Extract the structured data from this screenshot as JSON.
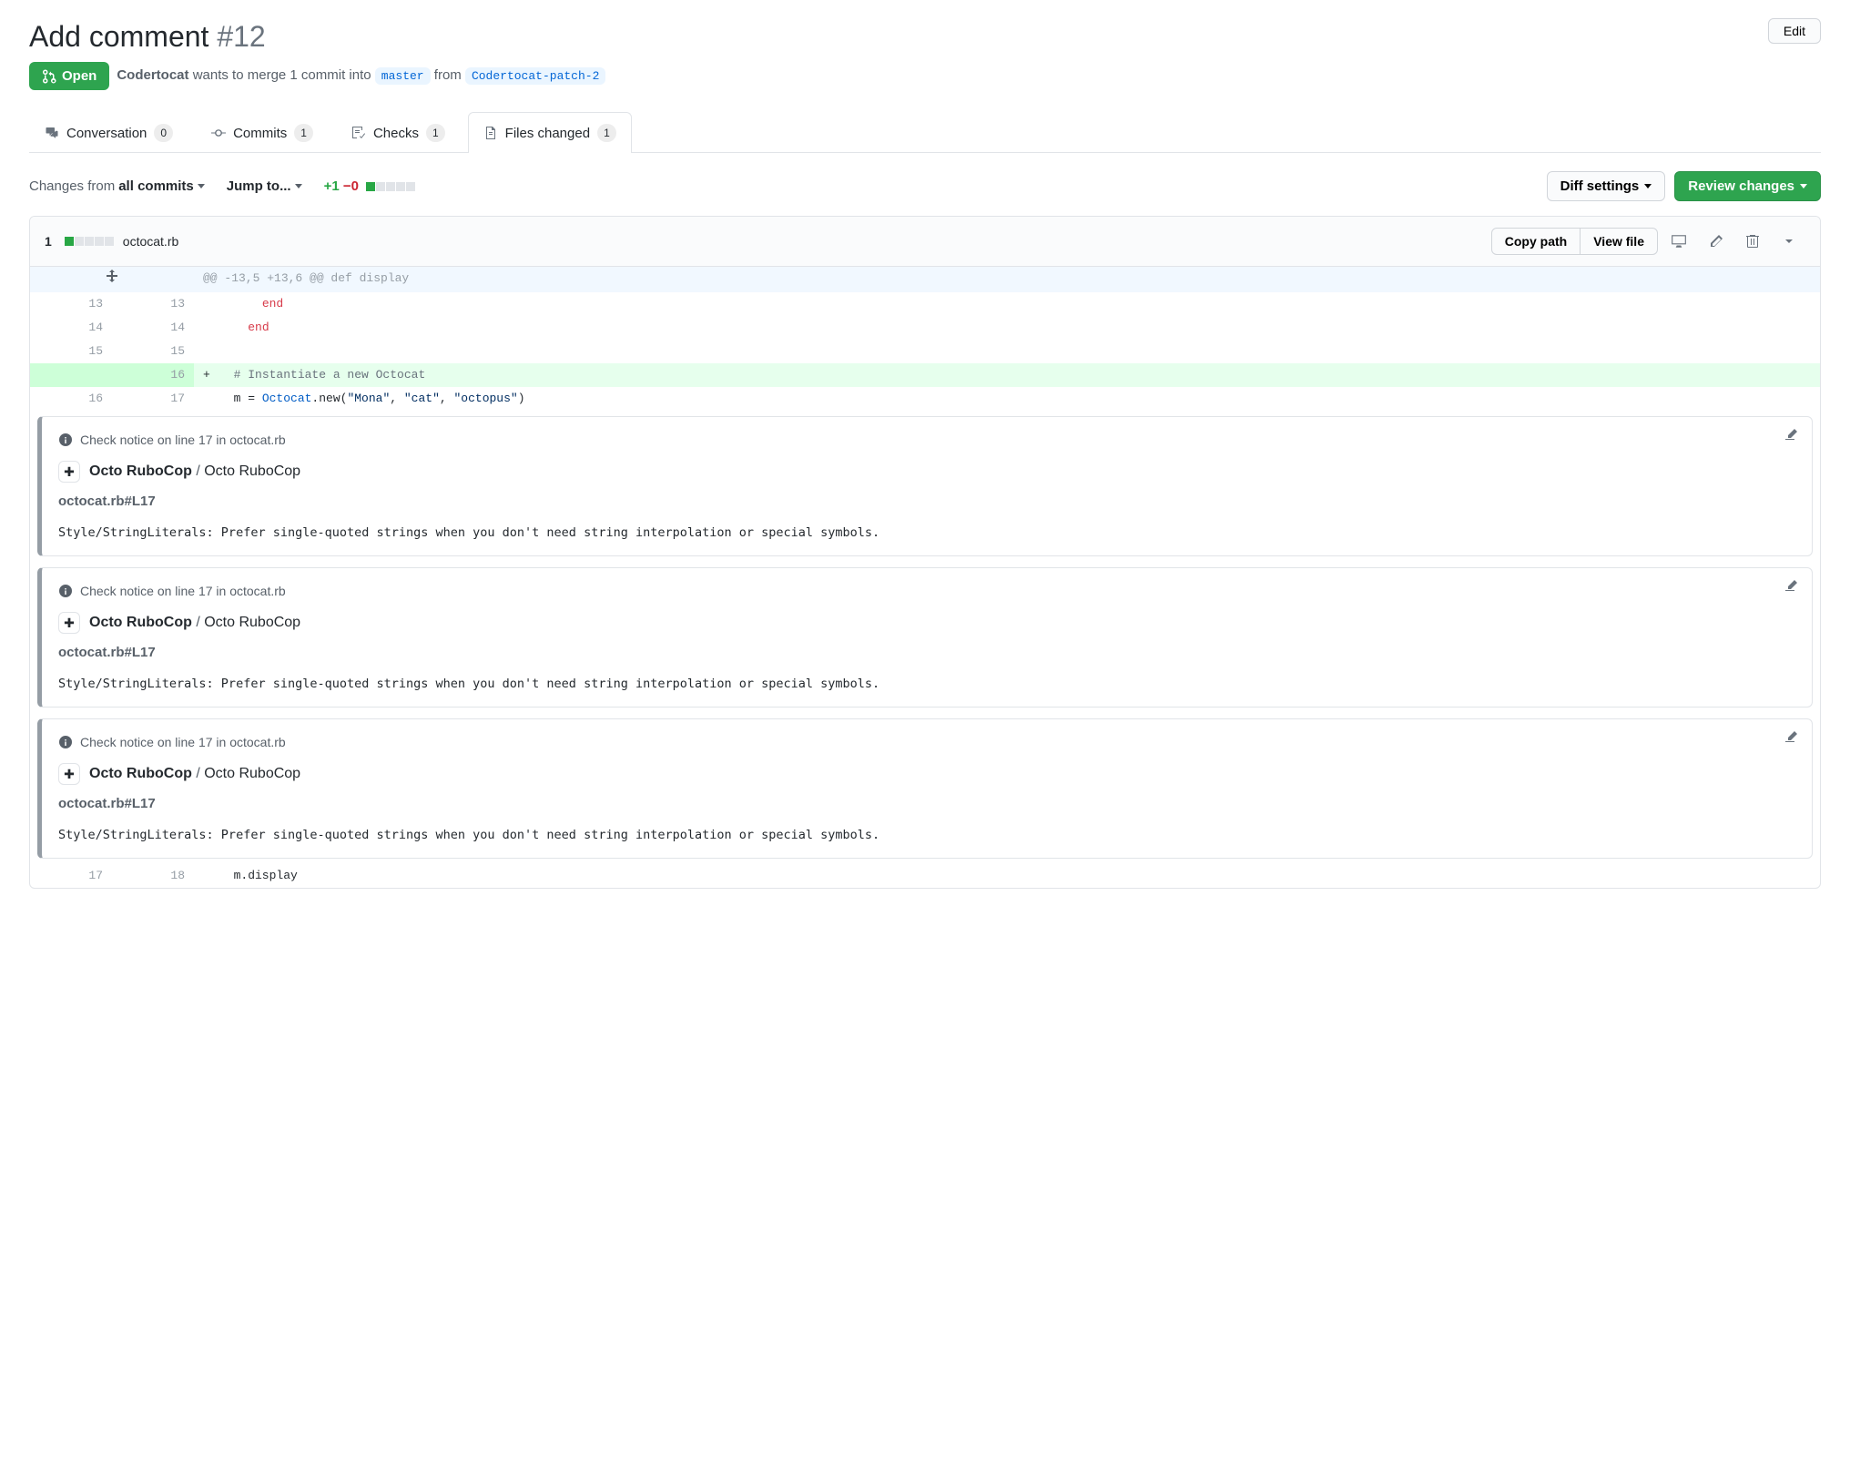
{
  "header": {
    "title": "Add comment",
    "number": "#12",
    "edit_button": "Edit",
    "state": "Open",
    "author": "Codertocat",
    "merge_text_1": "wants to merge 1 commit into",
    "base_branch": "master",
    "merge_text_2": "from",
    "head_branch": "Codertocat-patch-2"
  },
  "tabs": {
    "conversation": {
      "label": "Conversation",
      "count": "0"
    },
    "commits": {
      "label": "Commits",
      "count": "1"
    },
    "checks": {
      "label": "Checks",
      "count": "1"
    },
    "files": {
      "label": "Files changed",
      "count": "1"
    }
  },
  "toolbar": {
    "changes_from": "Changes from",
    "all_commits": "all commits",
    "jump_to": "Jump to...",
    "additions": "+1",
    "deletions": "−0",
    "diff_settings": "Diff settings",
    "review_changes": "Review changes"
  },
  "file": {
    "change_count": "1",
    "filename": "octocat.rb",
    "copy_path": "Copy path",
    "view_file": "View file"
  },
  "diff": {
    "hunk": "@@ -13,5 +13,6 @@ def display",
    "rows": [
      {
        "old": "13",
        "new": "13",
        "sym": " ",
        "code": "      <span class='kw-end'>end</span>",
        "cls": ""
      },
      {
        "old": "14",
        "new": "14",
        "sym": " ",
        "code": "    <span class='kw-end'>end</span>",
        "cls": ""
      },
      {
        "old": "15",
        "new": "15",
        "sym": " ",
        "code": "",
        "cls": ""
      },
      {
        "old": "",
        "new": "16",
        "sym": "+",
        "code": "  <span class='cmt'># Instantiate a new Octocat</span>",
        "cls": "add-row"
      },
      {
        "old": "16",
        "new": "17",
        "sym": " ",
        "code": "  m = <span class='kw-const'>Octocat</span>.new(<span class='kw-str'>\"Mona\"</span>, <span class='kw-str'>\"cat\"</span>, <span class='kw-str'>\"octopus\"</span>)",
        "cls": ""
      }
    ],
    "last_row": {
      "old": "17",
      "new": "18",
      "sym": " ",
      "code": "  m.display"
    }
  },
  "annotation": {
    "head": "Check notice on line 17 in octocat.rb",
    "app_name": "Octo RuboCop",
    "app_check": "Octo RuboCop",
    "location": "octocat.rb#L17",
    "message": "Style/StringLiterals: Prefer single-quoted strings when you don't need string interpolation or special symbols."
  }
}
